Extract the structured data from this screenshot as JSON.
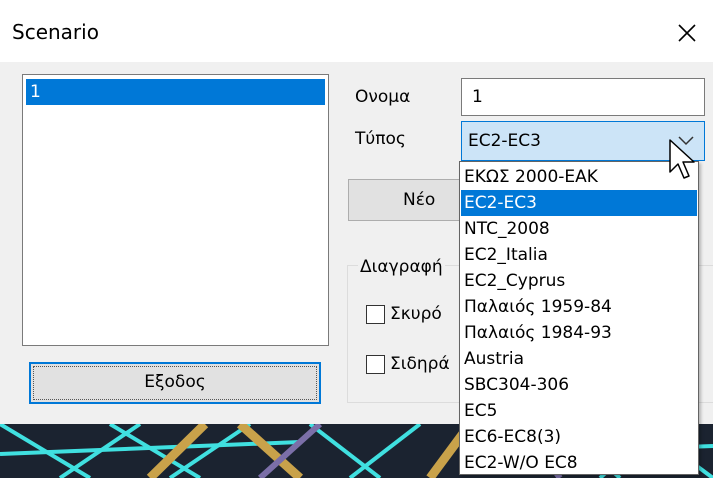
{
  "window": {
    "title": "Scenario"
  },
  "scenario_list": {
    "items": [
      "1"
    ]
  },
  "form": {
    "name_label": "Ονομα",
    "name_value": "1",
    "type_label": "Τύπος",
    "type_value": "EC2-EC3"
  },
  "buttons": {
    "new_label": "Νέο",
    "exit_label": "Εξοδος"
  },
  "delete_group": {
    "legend": "Διαγραφή",
    "checkbox_concrete": "Σκυρό",
    "checkbox_steel": "Σιδηρά"
  },
  "dropdown": {
    "selected_index": 1,
    "options": [
      "ΕΚΩΣ 2000-ΕΑΚ",
      "EC2-EC3",
      "NTC_2008",
      "EC2_Italia",
      "EC2_Cyprus",
      "Παλαιός 1959-84",
      "Παλαιός 1984-93",
      "Austria",
      "SBC304-306",
      "EC5",
      "EC6-EC8(3)",
      "EC2-W/O EC8"
    ]
  },
  "colors": {
    "accent": "#0078d7",
    "selection_text": "#ffffff",
    "dialog_bg": "#f0f0f0"
  },
  "icons": {
    "close": "close-icon",
    "combo_arrow": "chevron-down-icon",
    "cursor": "mouse-pointer-icon"
  }
}
